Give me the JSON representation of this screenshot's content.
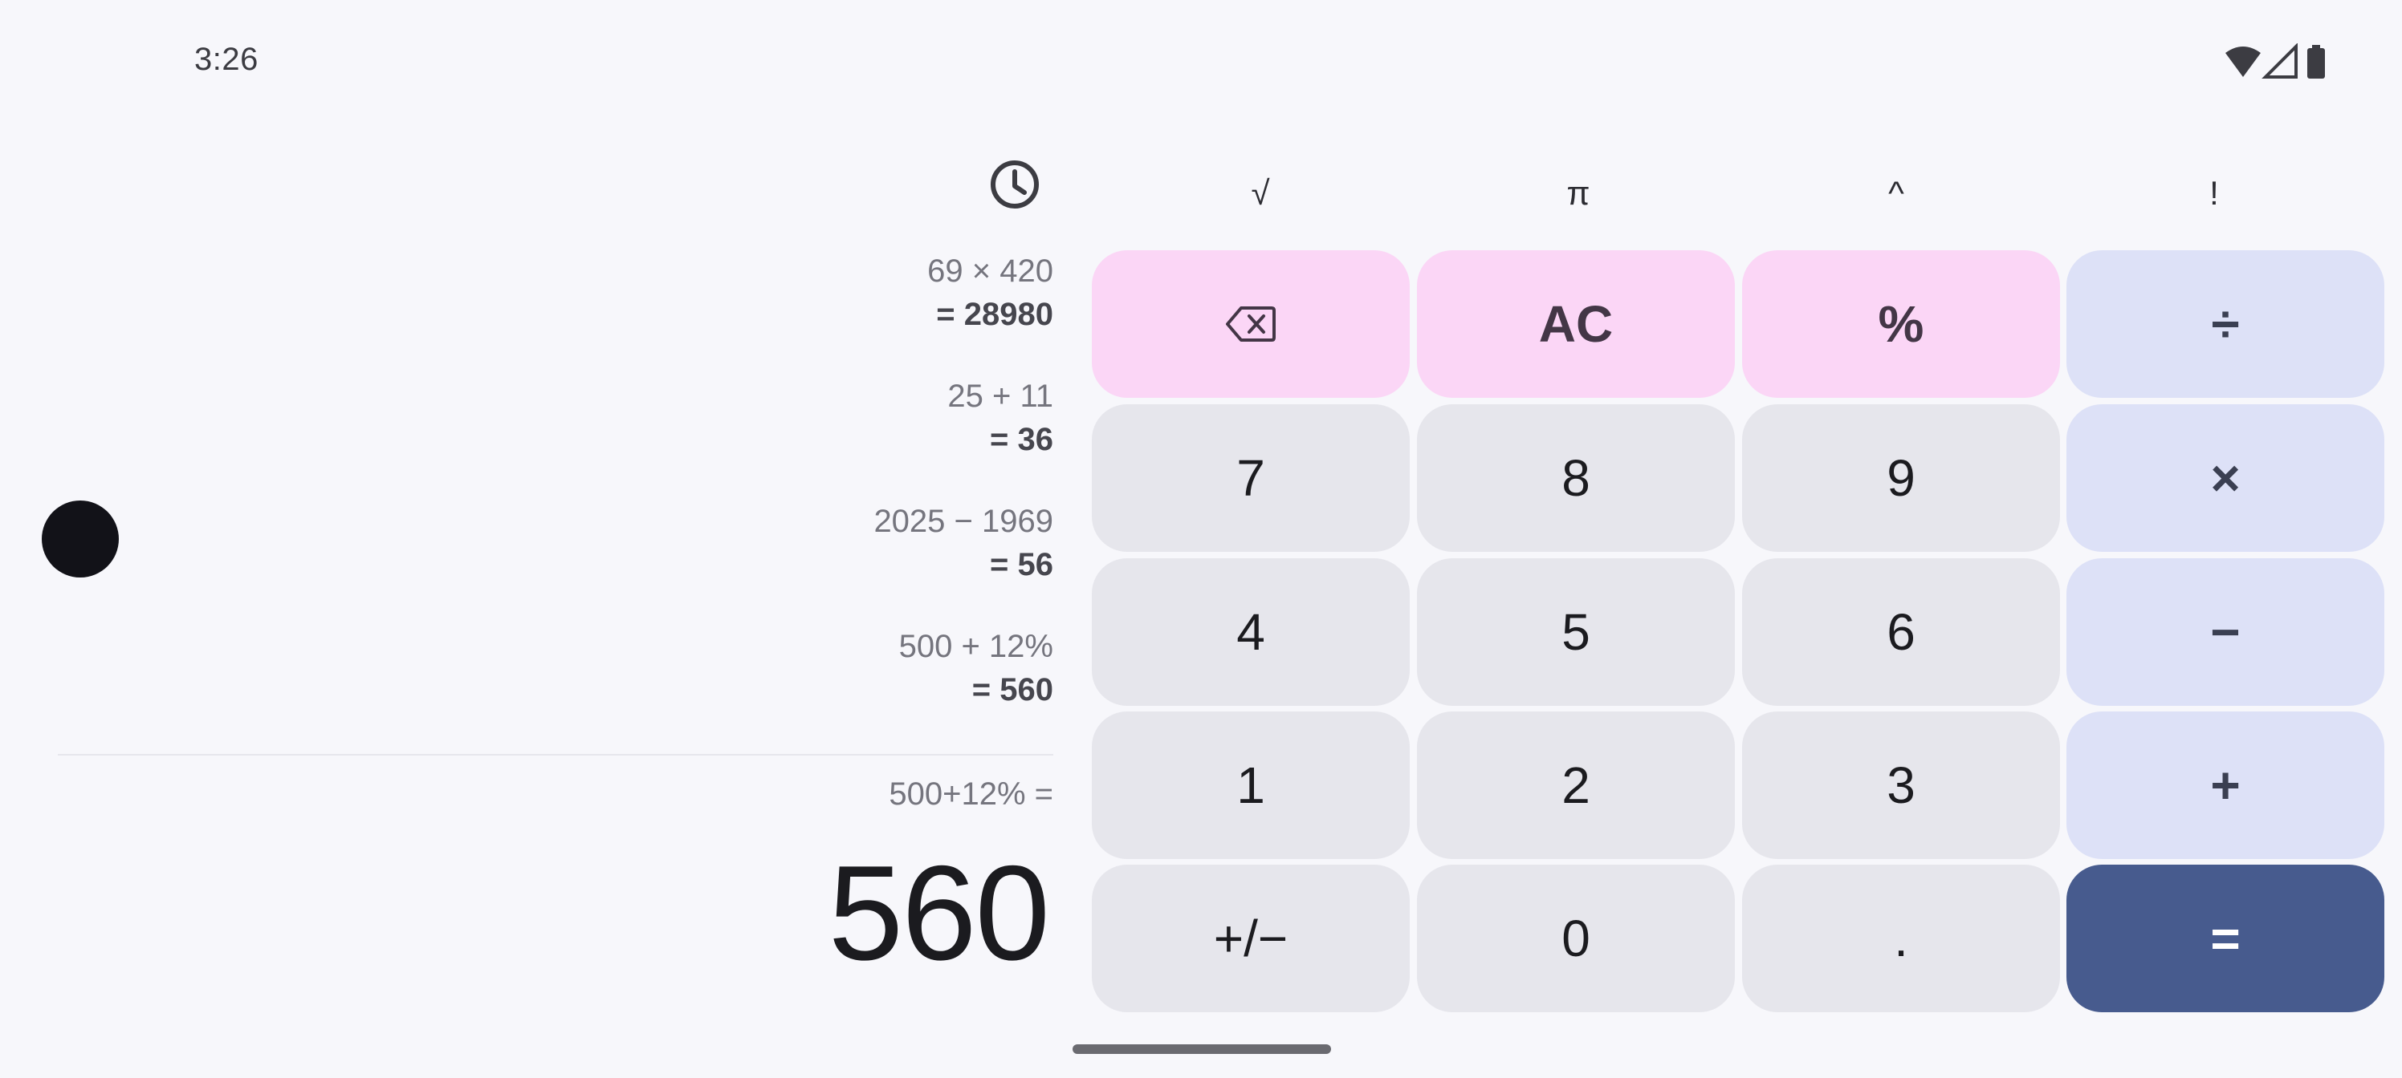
{
  "status_bar": {
    "time": "3:26",
    "icons": [
      "wifi-icon",
      "cell-signal-icon",
      "battery-icon"
    ]
  },
  "history": {
    "icon": "history-clock-icon",
    "entries": [
      {
        "expression": "69 × 420",
        "result": "= 28980"
      },
      {
        "expression": "25 + 11",
        "result": "= 36"
      },
      {
        "expression": "2025 − 1969",
        "result": "= 56"
      },
      {
        "expression": "500 + 12%",
        "result": "= 560"
      }
    ]
  },
  "display": {
    "expression": "500+12% =",
    "result": "560"
  },
  "scientific_row": [
    "√",
    "π",
    "^",
    "!"
  ],
  "keypad": {
    "backspace_icon": "backspace-icon",
    "rows": [
      [
        "",
        "AC",
        "%",
        "÷"
      ],
      [
        "7",
        "8",
        "9",
        "×"
      ],
      [
        "4",
        "5",
        "6",
        "−"
      ],
      [
        "1",
        "2",
        "3",
        "+"
      ],
      [
        "+/−",
        "0",
        ".",
        "="
      ]
    ]
  },
  "colors": {
    "background": "#f7f7fb",
    "number_key": "#e6e6ec",
    "function_key": "#fbd6f6",
    "operator_key": "#dde1f7",
    "equals_key": "#475b8e"
  }
}
